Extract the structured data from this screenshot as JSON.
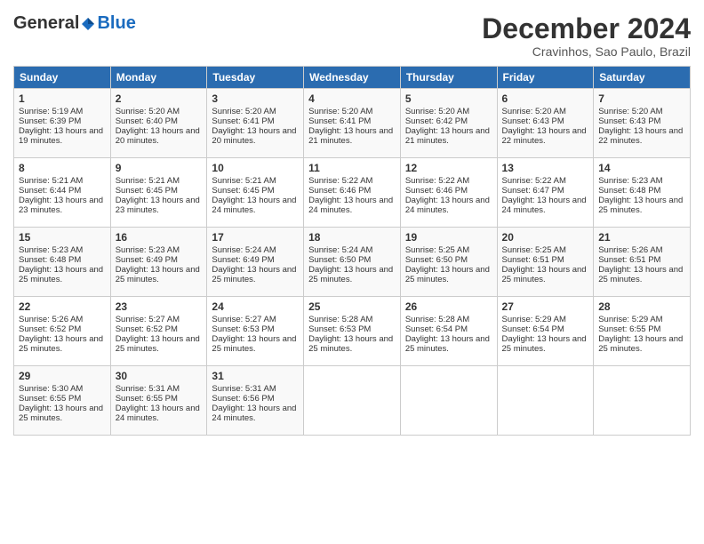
{
  "logo": {
    "general": "General",
    "blue": "Blue"
  },
  "title": "December 2024",
  "subtitle": "Cravinhos, Sao Paulo, Brazil",
  "days_header": [
    "Sunday",
    "Monday",
    "Tuesday",
    "Wednesday",
    "Thursday",
    "Friday",
    "Saturday"
  ],
  "weeks": [
    [
      {
        "day": "1",
        "sunrise": "5:19 AM",
        "sunset": "6:39 PM",
        "daylight": "13 hours and 19 minutes."
      },
      {
        "day": "2",
        "sunrise": "5:20 AM",
        "sunset": "6:40 PM",
        "daylight": "13 hours and 20 minutes."
      },
      {
        "day": "3",
        "sunrise": "5:20 AM",
        "sunset": "6:41 PM",
        "daylight": "13 hours and 20 minutes."
      },
      {
        "day": "4",
        "sunrise": "5:20 AM",
        "sunset": "6:41 PM",
        "daylight": "13 hours and 21 minutes."
      },
      {
        "day": "5",
        "sunrise": "5:20 AM",
        "sunset": "6:42 PM",
        "daylight": "13 hours and 21 minutes."
      },
      {
        "day": "6",
        "sunrise": "5:20 AM",
        "sunset": "6:43 PM",
        "daylight": "13 hours and 22 minutes."
      },
      {
        "day": "7",
        "sunrise": "5:20 AM",
        "sunset": "6:43 PM",
        "daylight": "13 hours and 22 minutes."
      }
    ],
    [
      {
        "day": "8",
        "sunrise": "5:21 AM",
        "sunset": "6:44 PM",
        "daylight": "13 hours and 23 minutes."
      },
      {
        "day": "9",
        "sunrise": "5:21 AM",
        "sunset": "6:45 PM",
        "daylight": "13 hours and 23 minutes."
      },
      {
        "day": "10",
        "sunrise": "5:21 AM",
        "sunset": "6:45 PM",
        "daylight": "13 hours and 24 minutes."
      },
      {
        "day": "11",
        "sunrise": "5:22 AM",
        "sunset": "6:46 PM",
        "daylight": "13 hours and 24 minutes."
      },
      {
        "day": "12",
        "sunrise": "5:22 AM",
        "sunset": "6:46 PM",
        "daylight": "13 hours and 24 minutes."
      },
      {
        "day": "13",
        "sunrise": "5:22 AM",
        "sunset": "6:47 PM",
        "daylight": "13 hours and 24 minutes."
      },
      {
        "day": "14",
        "sunrise": "5:23 AM",
        "sunset": "6:48 PM",
        "daylight": "13 hours and 25 minutes."
      }
    ],
    [
      {
        "day": "15",
        "sunrise": "5:23 AM",
        "sunset": "6:48 PM",
        "daylight": "13 hours and 25 minutes."
      },
      {
        "day": "16",
        "sunrise": "5:23 AM",
        "sunset": "6:49 PM",
        "daylight": "13 hours and 25 minutes."
      },
      {
        "day": "17",
        "sunrise": "5:24 AM",
        "sunset": "6:49 PM",
        "daylight": "13 hours and 25 minutes."
      },
      {
        "day": "18",
        "sunrise": "5:24 AM",
        "sunset": "6:50 PM",
        "daylight": "13 hours and 25 minutes."
      },
      {
        "day": "19",
        "sunrise": "5:25 AM",
        "sunset": "6:50 PM",
        "daylight": "13 hours and 25 minutes."
      },
      {
        "day": "20",
        "sunrise": "5:25 AM",
        "sunset": "6:51 PM",
        "daylight": "13 hours and 25 minutes."
      },
      {
        "day": "21",
        "sunrise": "5:26 AM",
        "sunset": "6:51 PM",
        "daylight": "13 hours and 25 minutes."
      }
    ],
    [
      {
        "day": "22",
        "sunrise": "5:26 AM",
        "sunset": "6:52 PM",
        "daylight": "13 hours and 25 minutes."
      },
      {
        "day": "23",
        "sunrise": "5:27 AM",
        "sunset": "6:52 PM",
        "daylight": "13 hours and 25 minutes."
      },
      {
        "day": "24",
        "sunrise": "5:27 AM",
        "sunset": "6:53 PM",
        "daylight": "13 hours and 25 minutes."
      },
      {
        "day": "25",
        "sunrise": "5:28 AM",
        "sunset": "6:53 PM",
        "daylight": "13 hours and 25 minutes."
      },
      {
        "day": "26",
        "sunrise": "5:28 AM",
        "sunset": "6:54 PM",
        "daylight": "13 hours and 25 minutes."
      },
      {
        "day": "27",
        "sunrise": "5:29 AM",
        "sunset": "6:54 PM",
        "daylight": "13 hours and 25 minutes."
      },
      {
        "day": "28",
        "sunrise": "5:29 AM",
        "sunset": "6:55 PM",
        "daylight": "13 hours and 25 minutes."
      }
    ],
    [
      {
        "day": "29",
        "sunrise": "5:30 AM",
        "sunset": "6:55 PM",
        "daylight": "13 hours and 25 minutes."
      },
      {
        "day": "30",
        "sunrise": "5:31 AM",
        "sunset": "6:55 PM",
        "daylight": "13 hours and 24 minutes."
      },
      {
        "day": "31",
        "sunrise": "5:31 AM",
        "sunset": "6:56 PM",
        "daylight": "13 hours and 24 minutes."
      },
      null,
      null,
      null,
      null
    ]
  ]
}
